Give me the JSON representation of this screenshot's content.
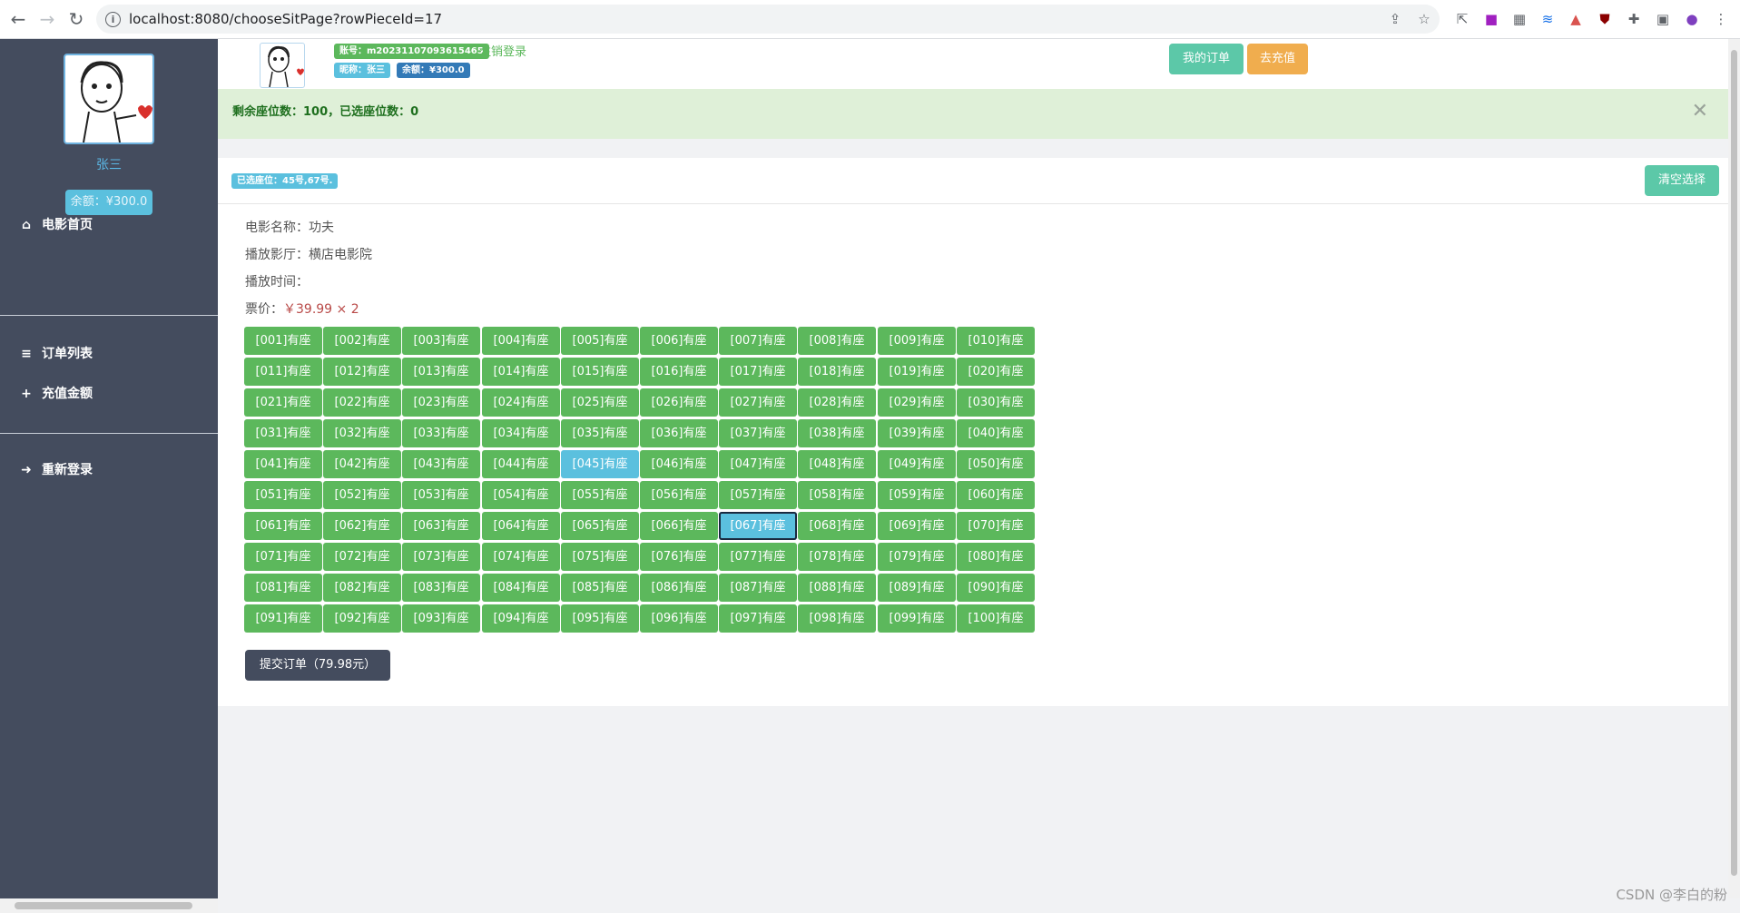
{
  "browser": {
    "url": "localhost:8080/chooseSitPage?rowPieceId=17"
  },
  "sidebar": {
    "user_name": "张三",
    "balance": "余额：¥300.0",
    "menu": [
      {
        "label": "电影首页",
        "icon": "home-icon"
      },
      {
        "label": "订单列表",
        "icon": "list-icon"
      },
      {
        "label": "充值金额",
        "icon": "plus-icon"
      },
      {
        "label": "重新登录",
        "icon": "sign-in-icon"
      }
    ]
  },
  "header": {
    "account": "账号：m20231107093615465",
    "logout": "注销登录",
    "nickname": "昵称：张三",
    "balance": "余额：¥300.0",
    "my_orders": "我的订单",
    "recharge": "去充值"
  },
  "alert": {
    "text": "剩余座位数：100，已选座位数：0"
  },
  "panel": {
    "selected": "已选座位：45号,67号.",
    "clear": "清空选择",
    "movie_name": "电影名称：功夫",
    "hall": "播放影厅：横店电影院",
    "time": "播放时间：",
    "price_label": "票价：",
    "price_value": "￥39.99 × 2",
    "submit": "提交订单（79.98元）"
  },
  "seats": {
    "status_text": "有座",
    "selected": [
      "045",
      "067"
    ],
    "total": 100,
    "per_row": 10,
    "colors": {
      "available": "#5cb85c",
      "selected": "#5bc0de"
    }
  },
  "watermark": "CSDN @李白的粉"
}
